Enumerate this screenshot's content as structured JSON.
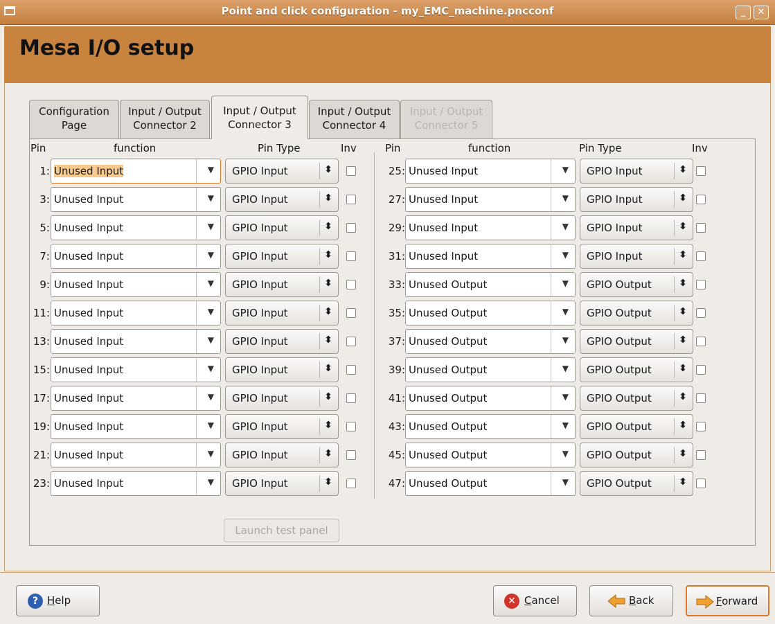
{
  "window": {
    "title": "Point and click configuration - my_EMC_machine.pncconf"
  },
  "header": {
    "title": "Mesa I/O setup"
  },
  "tabs": [
    {
      "line1": "Configuration",
      "line2": "Page"
    },
    {
      "line1": "Input / Output",
      "line2": "Connector 2"
    },
    {
      "line1": "Input / Output",
      "line2": "Connector 3"
    },
    {
      "line1": "Input / Output",
      "line2": "Connector 4"
    },
    {
      "line1": "Input / Output",
      "line2": "Connector 5"
    }
  ],
  "columns": {
    "pin": "Pin",
    "function": "function",
    "pin_type": "Pin Type",
    "inv": "Inv"
  },
  "left_rows": [
    {
      "pin": "1:",
      "function": "Unused Input",
      "type": "GPIO Input"
    },
    {
      "pin": "3:",
      "function": "Unused Input",
      "type": "GPIO Input"
    },
    {
      "pin": "5:",
      "function": "Unused Input",
      "type": "GPIO Input"
    },
    {
      "pin": "7:",
      "function": "Unused Input",
      "type": "GPIO Input"
    },
    {
      "pin": "9:",
      "function": "Unused Input",
      "type": "GPIO Input"
    },
    {
      "pin": "11:",
      "function": "Unused Input",
      "type": "GPIO Input"
    },
    {
      "pin": "13:",
      "function": "Unused Input",
      "type": "GPIO Input"
    },
    {
      "pin": "15:",
      "function": "Unused Input",
      "type": "GPIO Input"
    },
    {
      "pin": "17:",
      "function": "Unused Input",
      "type": "GPIO Input"
    },
    {
      "pin": "19:",
      "function": "Unused Input",
      "type": "GPIO Input"
    },
    {
      "pin": "21:",
      "function": "Unused Input",
      "type": "GPIO Input"
    },
    {
      "pin": "23:",
      "function": "Unused Input",
      "type": "GPIO Input"
    }
  ],
  "right_rows": [
    {
      "pin": "25:",
      "function": "Unused Input",
      "type": "GPIO Input"
    },
    {
      "pin": "27:",
      "function": "Unused Input",
      "type": "GPIO Input"
    },
    {
      "pin": "29:",
      "function": "Unused Input",
      "type": "GPIO Input"
    },
    {
      "pin": "31:",
      "function": "Unused Input",
      "type": "GPIO Input"
    },
    {
      "pin": "33:",
      "function": "Unused Output",
      "type": "GPIO Output"
    },
    {
      "pin": "35:",
      "function": "Unused Output",
      "type": "GPIO Output"
    },
    {
      "pin": "37:",
      "function": "Unused Output",
      "type": "GPIO Output"
    },
    {
      "pin": "39:",
      "function": "Unused Output",
      "type": "GPIO Output"
    },
    {
      "pin": "41:",
      "function": "Unused Output",
      "type": "GPIO Output"
    },
    {
      "pin": "43:",
      "function": "Unused Output",
      "type": "GPIO Output"
    },
    {
      "pin": "45:",
      "function": "Unused Output",
      "type": "GPIO Output"
    },
    {
      "pin": "47:",
      "function": "Unused Output",
      "type": "GPIO Output"
    }
  ],
  "test_button": "Launch test panel",
  "buttons": {
    "help": "Help",
    "cancel": "Cancel",
    "back": "Back",
    "forward": "Forward"
  },
  "colors": {
    "accent": "#c8843e",
    "focus": "#e07a2a",
    "selection": "#f7c98f"
  }
}
